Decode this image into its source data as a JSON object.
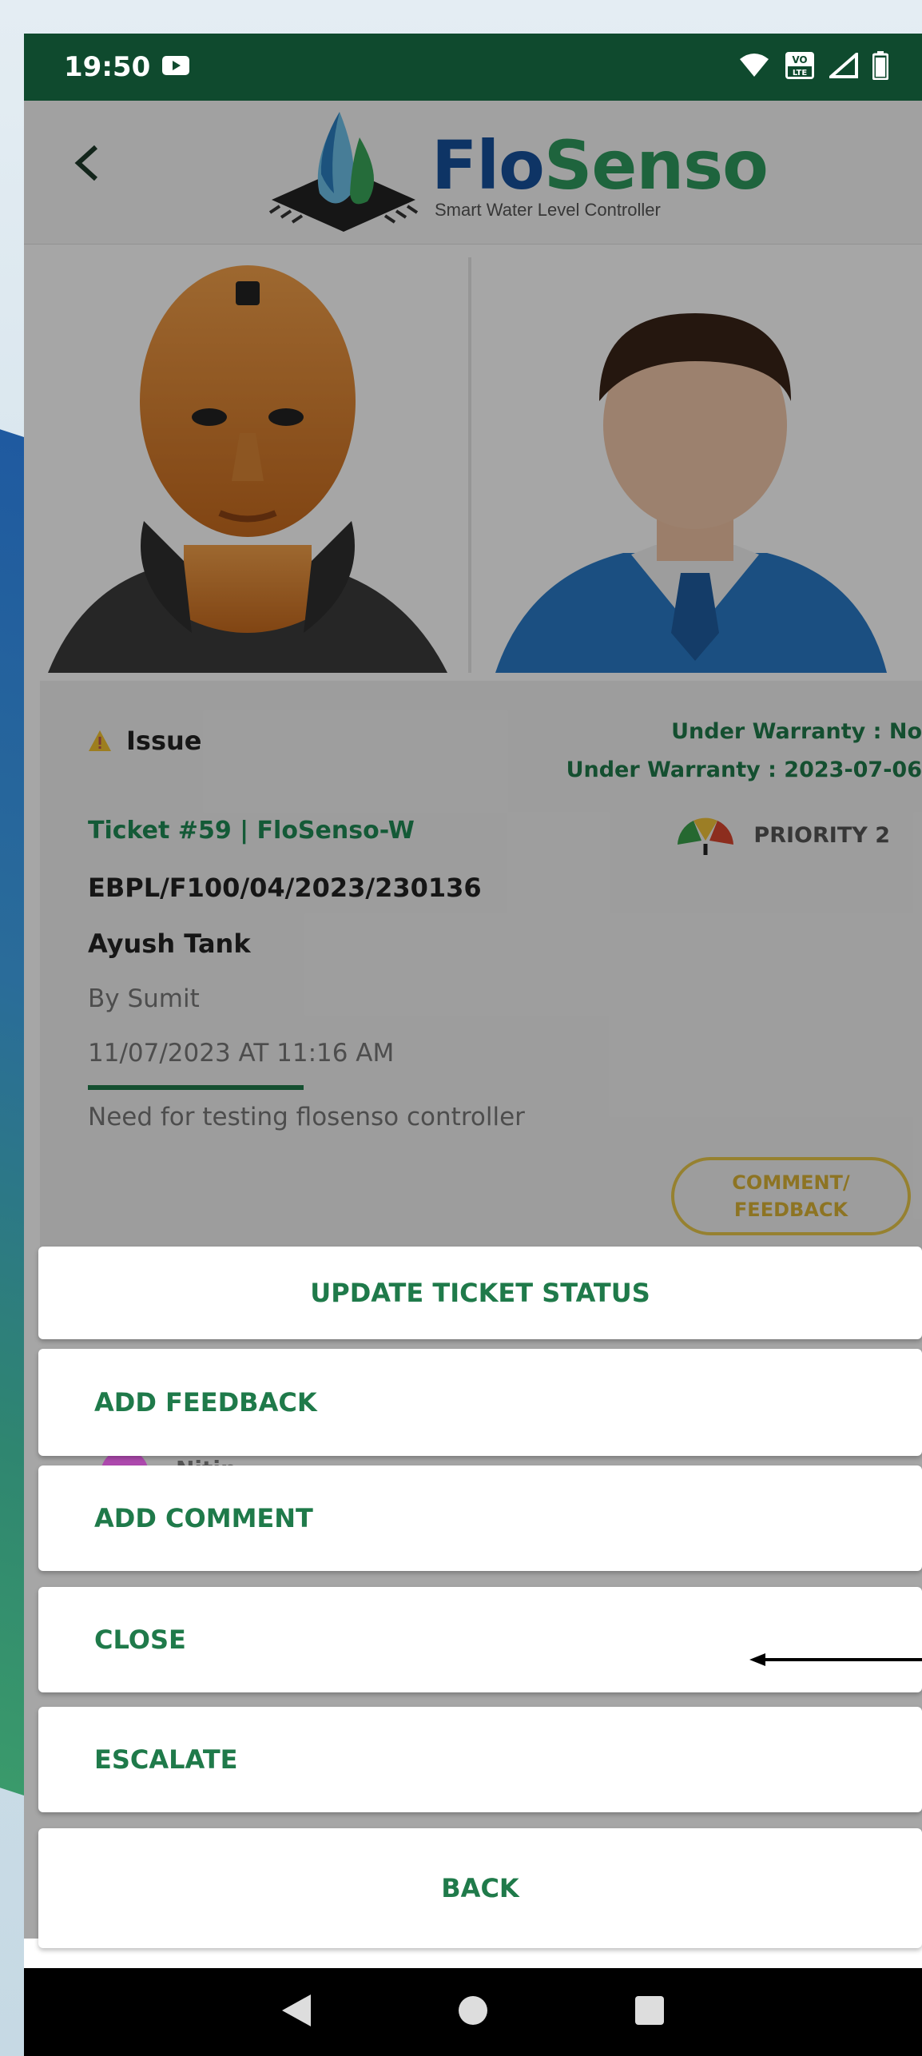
{
  "status_bar": {
    "time": "19:50",
    "icons": [
      "media-icon",
      "wifi-icon",
      "volte-lte-icon",
      "signal-icon",
      "battery-icon"
    ],
    "volte_top": "VO",
    "volte_bottom": "LTE"
  },
  "header": {
    "back_icon": "back-arrow-icon",
    "logo_flo": "Flo",
    "logo_senso": "Senso",
    "logo_tagline": "Smart Water Level Controller"
  },
  "ticket": {
    "issue_label": "Issue",
    "warranty_line1": "Under Warranty : No",
    "warranty_line2": "Under Warranty : 2023-07-06",
    "ticket_title": "Ticket #59 | FloSenso-W",
    "priority": "PRIORITY 2",
    "serial": "EBPL/F100/04/2023/230136",
    "customer": "Ayush Tank",
    "created_by": "By Sumit",
    "created_at": "11/07/2023 AT 11:16 AM",
    "description": "Need for testing flosenso controller",
    "comment_button": "COMMENT/ FEEDBACK",
    "peek_name": "Nitin"
  },
  "action_sheet": {
    "title": "UPDATE TICKET STATUS",
    "items": [
      "ADD FEEDBACK",
      "ADD COMMENT",
      "CLOSE",
      "ESCALATE"
    ],
    "back": "BACK"
  },
  "colors": {
    "status_bar": "#0f4a2e",
    "accent_green": "#1f7a4a",
    "brand_blue": "#16509c",
    "brand_green": "#2f9a5e",
    "feedback_yellow": "#e6c74a"
  },
  "nav_bar": {
    "icons": [
      "back-triangle-icon",
      "home-circle-icon",
      "recents-square-icon"
    ]
  }
}
